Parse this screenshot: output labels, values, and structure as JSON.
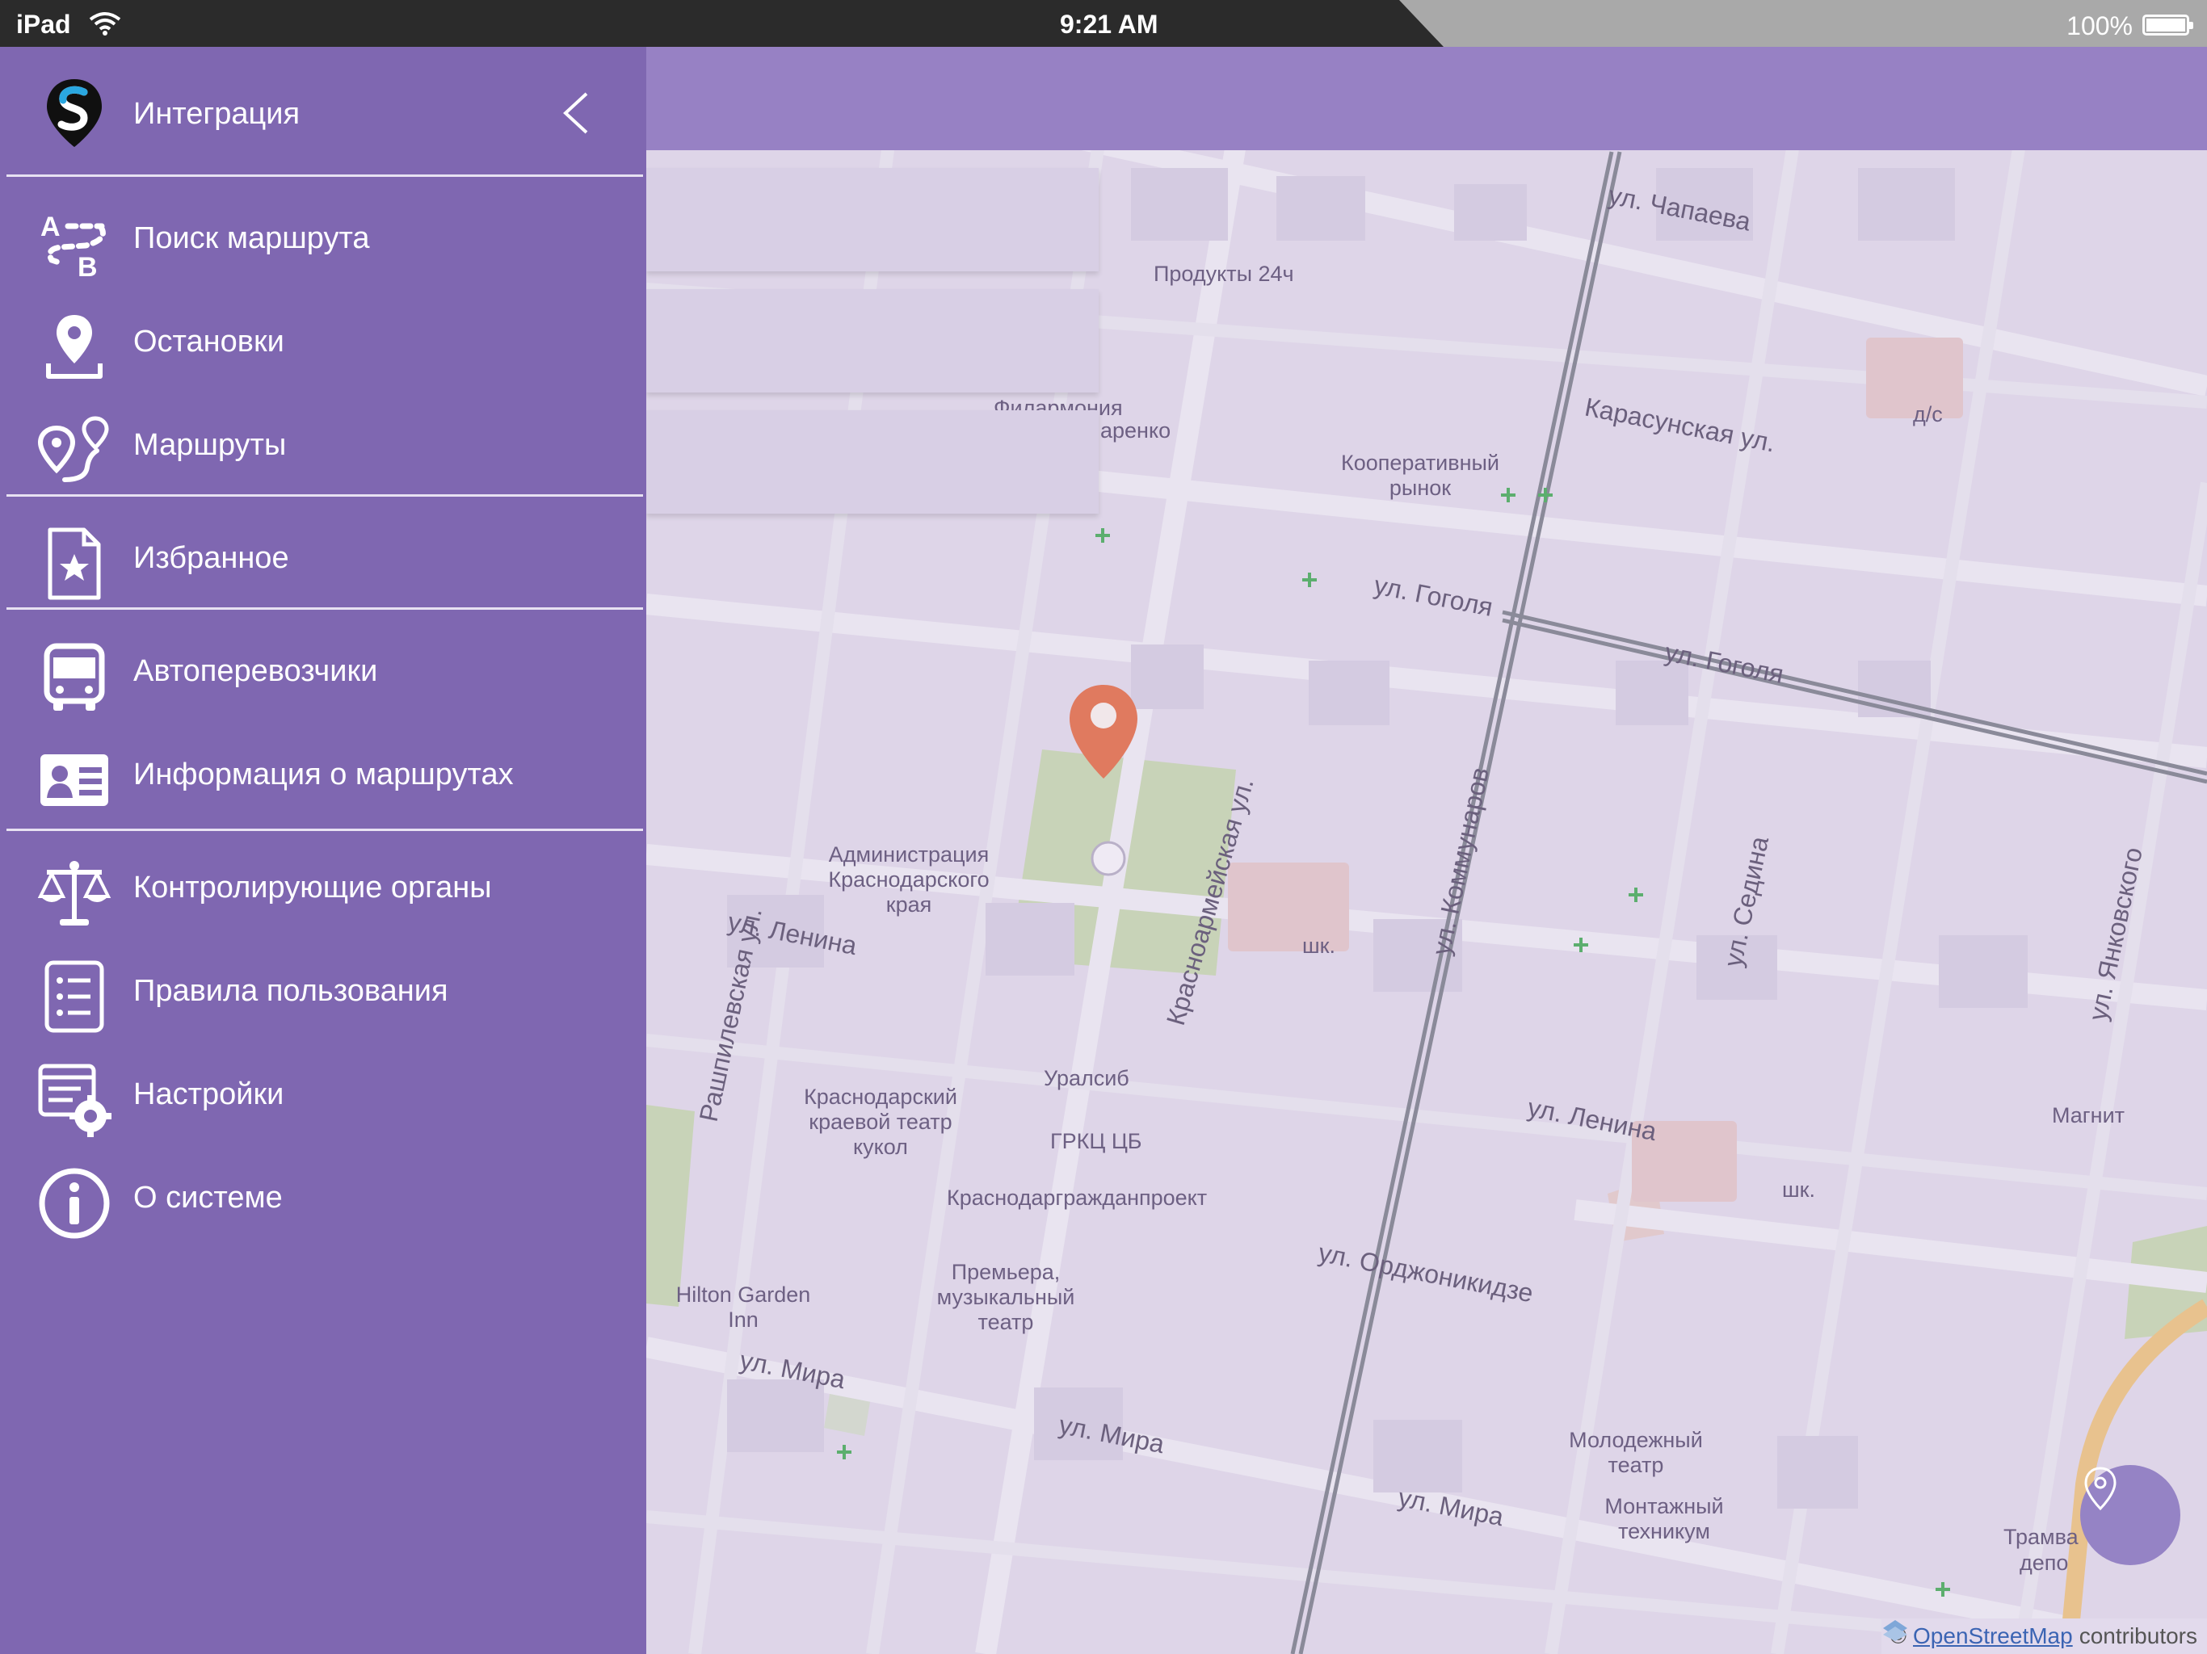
{
  "status_bar": {
    "device": "iPad",
    "time": "9:21 AM",
    "battery": "100%"
  },
  "sidebar": {
    "app_title": "Интеграция",
    "items": [
      {
        "label": "Поиск маршрута",
        "icon": "route-search-icon"
      },
      {
        "label": "Остановки",
        "icon": "stop-pin-icon"
      },
      {
        "label": "Маршруты",
        "icon": "routes-icon"
      },
      {
        "label": "Избранное",
        "icon": "favorites-icon"
      },
      {
        "label": "Автоперевозчики",
        "icon": "bus-icon"
      },
      {
        "label": "Информация о маршрутах",
        "icon": "id-card-icon"
      },
      {
        "label": "Контролирующие органы",
        "icon": "scales-icon"
      },
      {
        "label": "Правила пользования",
        "icon": "list-icon"
      },
      {
        "label": "Настройки",
        "icon": "settings-icon"
      },
      {
        "label": "О системе",
        "icon": "info-icon"
      }
    ]
  },
  "map": {
    "streets": {
      "chapaeva": "ул. Чапаева",
      "karasunskaya": "Карасунская ул.",
      "gogolya_1": "ул. Гоголя",
      "gogolya_2": "ул. Гоголя",
      "krasnoarmeyskaya": "Красноармейская ул.",
      "kommunarov": "ул. Коммунаров",
      "sedina": "ул. Седина",
      "yankovskogo": "ул. Янковского",
      "lenina_1": "ул. Ленина",
      "lenina_2": "ул. Ленина",
      "rashpilevskaya": "Рашпилевская ул.",
      "ordzhonikidze": "ул. Орджоникидзе",
      "mira_1": "ул. Мира",
      "mira_2": "ул. Мира",
      "mira_3": "ул. Мира"
    },
    "pois": {
      "produkty": "Продукты 24ч",
      "filarmoniya": "Филармония",
      "renko": "аренко",
      "kooperativny": "Кооперативный рынок",
      "administraciya": "Администрация Краснодарского края",
      "uralsib": "Уралсиб",
      "grkc": "ГРКЦ ЦБ",
      "teatr_kukol": "Краснодарский краевой театр кукол",
      "krasnodargrazhdan": "Краснодаргражданпроект",
      "premiera": "Премьера, музыкальный театр",
      "hilton": "Hilton Garden Inn",
      "molodezhny": "Молодежный театр",
      "montazhny": "Монтажный техникум",
      "magnit": "Магнит",
      "ds": "д/с",
      "shk1": "шк.",
      "shk2": "шк.",
      "tramvaynoe": "Трамва",
      "depo": "депо"
    }
  },
  "attribution": {
    "prefix": "©",
    "link": "OpenStreetMap",
    "suffix": "contributors"
  },
  "colors": {
    "sidebar": "#7f67b1",
    "map_topbar": "#9781c4",
    "marker": "#e07a5f",
    "fab": "#9583c5"
  }
}
